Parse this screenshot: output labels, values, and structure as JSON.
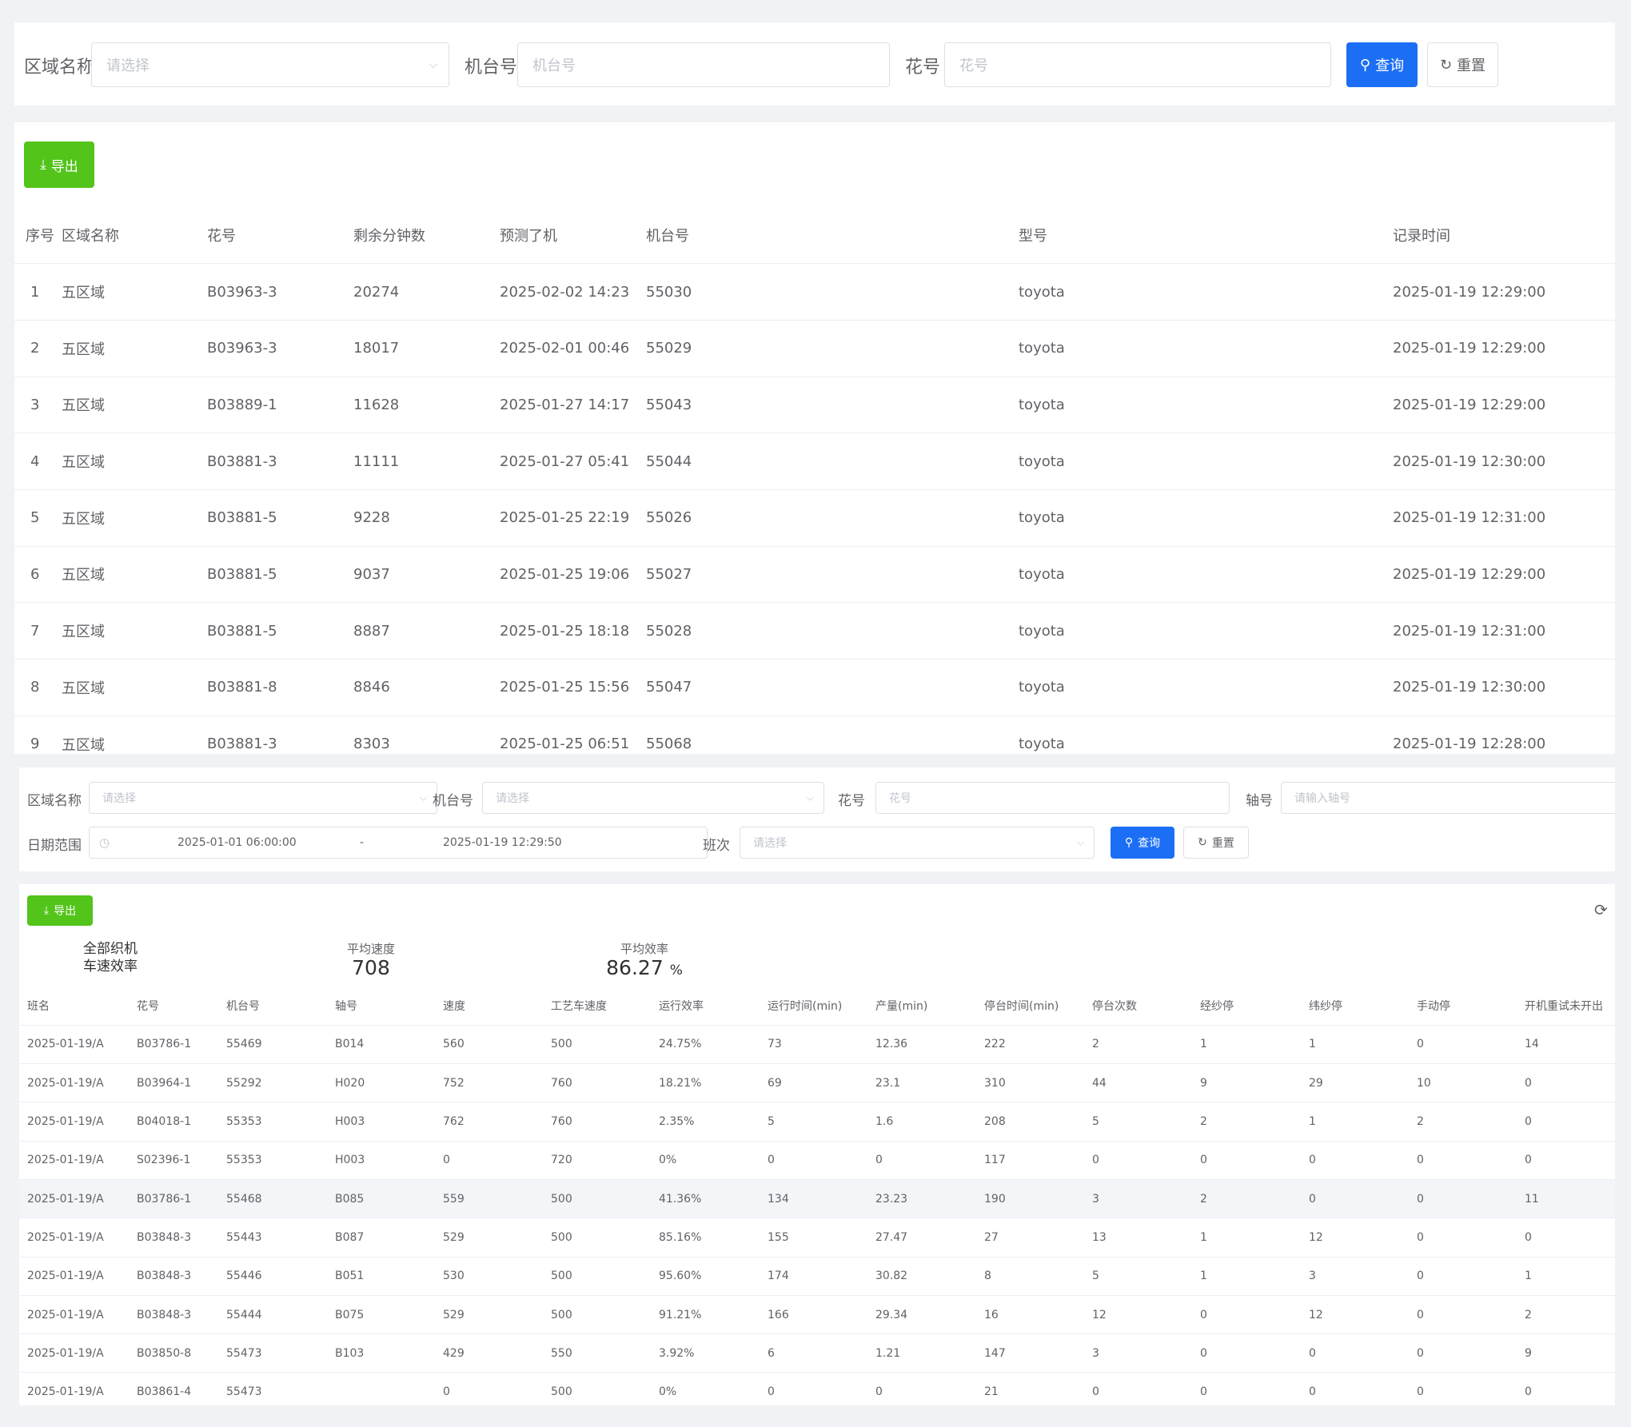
{
  "filter1": {
    "area_label": "区域名称",
    "area_placeholder": "请选择",
    "machine_label": "机台号",
    "machine_placeholder": "机台号",
    "pattern_label": "花号",
    "pattern_placeholder": "花号",
    "query_label": "查询",
    "reset_label": "重置"
  },
  "table1": {
    "export_label": "导出",
    "headers": [
      "序号",
      "区域名称",
      "花号",
      "剩余分钟数",
      "预测了机",
      "机台号",
      "型号",
      "记录时间"
    ],
    "rows": [
      [
        "1",
        "五区域",
        "B03963-3",
        "20274",
        "2025-02-02 14:23",
        "55030",
        "toyota",
        "2025-01-19 12:29:00"
      ],
      [
        "2",
        "五区域",
        "B03963-3",
        "18017",
        "2025-02-01 00:46",
        "55029",
        "toyota",
        "2025-01-19 12:29:00"
      ],
      [
        "3",
        "五区域",
        "B03889-1",
        "11628",
        "2025-01-27 14:17",
        "55043",
        "toyota",
        "2025-01-19 12:29:00"
      ],
      [
        "4",
        "五区域",
        "B03881-3",
        "11111",
        "2025-01-27 05:41",
        "55044",
        "toyota",
        "2025-01-19 12:30:00"
      ],
      [
        "5",
        "五区域",
        "B03881-5",
        "9228",
        "2025-01-25 22:19",
        "55026",
        "toyota",
        "2025-01-19 12:31:00"
      ],
      [
        "6",
        "五区域",
        "B03881-5",
        "9037",
        "2025-01-25 19:06",
        "55027",
        "toyota",
        "2025-01-19 12:29:00"
      ],
      [
        "7",
        "五区域",
        "B03881-5",
        "8887",
        "2025-01-25 18:18",
        "55028",
        "toyota",
        "2025-01-19 12:31:00"
      ],
      [
        "8",
        "五区域",
        "B03881-8",
        "8846",
        "2025-01-25 15:56",
        "55047",
        "toyota",
        "2025-01-19 12:30:00"
      ],
      [
        "9",
        "五区域",
        "B03881-3",
        "8303",
        "2025-01-25 06:51",
        "55068",
        "toyota",
        "2025-01-19 12:28:00"
      ]
    ]
  },
  "filter2": {
    "area_label": "区域名称",
    "area_placeholder": "请选择",
    "machine_label": "机台号",
    "machine_placeholder": "请选择",
    "pattern_label": "花号",
    "pattern_placeholder": "花号",
    "axis_label": "轴号",
    "axis_placeholder": "请输入轴号",
    "date_label": "日期范围",
    "date_start": "2025-01-01 06:00:00",
    "date_sep": "-",
    "date_end": "2025-01-19 12:29:50",
    "shift_label": "班次",
    "shift_placeholder": "请选择",
    "query_label": "查询",
    "reset_label": "重置"
  },
  "table2": {
    "export_label": "导出",
    "stats": {
      "title_line1": "全部织机",
      "title_line2": "车速效率",
      "avg_speed_label": "平均速度",
      "avg_speed_value": "708",
      "avg_eff_label": "平均效率",
      "avg_eff_value": "86.27",
      "avg_eff_unit": "%"
    },
    "headers": [
      "班名",
      "花号",
      "机台号",
      "轴号",
      "速度",
      "工艺车速度",
      "运行效率",
      "运行时间(min)",
      "产量(min)",
      "停台时间(min)",
      "停台次数",
      "经纱停",
      "纬纱停",
      "手动停",
      "开机重试未开出"
    ],
    "rows": [
      [
        "2025-01-19/A",
        "B03786-1",
        "55469",
        "B014",
        "560",
        "500",
        "24.75%",
        "73",
        "12.36",
        "222",
        "2",
        "1",
        "1",
        "0",
        "14"
      ],
      [
        "2025-01-19/A",
        "B03964-1",
        "55292",
        "H020",
        "752",
        "760",
        "18.21%",
        "69",
        "23.1",
        "310",
        "44",
        "9",
        "29",
        "10",
        "0"
      ],
      [
        "2025-01-19/A",
        "B04018-1",
        "55353",
        "H003",
        "762",
        "760",
        "2.35%",
        "5",
        "1.6",
        "208",
        "5",
        "2",
        "1",
        "2",
        "0"
      ],
      [
        "2025-01-19/A",
        "S02396-1",
        "55353",
        "H003",
        "0",
        "720",
        "0%",
        "0",
        "0",
        "117",
        "0",
        "0",
        "0",
        "0",
        "0"
      ],
      [
        "2025-01-19/A",
        "B03786-1",
        "55468",
        "B085",
        "559",
        "500",
        "41.36%",
        "134",
        "23.23",
        "190",
        "3",
        "2",
        "0",
        "0",
        "11"
      ],
      [
        "2025-01-19/A",
        "B03848-3",
        "55443",
        "B087",
        "529",
        "500",
        "85.16%",
        "155",
        "27.47",
        "27",
        "13",
        "1",
        "12",
        "0",
        "0"
      ],
      [
        "2025-01-19/A",
        "B03848-3",
        "55446",
        "B051",
        "530",
        "500",
        "95.60%",
        "174",
        "30.82",
        "8",
        "5",
        "1",
        "3",
        "0",
        "1"
      ],
      [
        "2025-01-19/A",
        "B03848-3",
        "55444",
        "B075",
        "529",
        "500",
        "91.21%",
        "166",
        "29.34",
        "16",
        "12",
        "0",
        "12",
        "0",
        "2"
      ],
      [
        "2025-01-19/A",
        "B03850-8",
        "55473",
        "B103",
        "429",
        "550",
        "3.92%",
        "6",
        "1.21",
        "147",
        "3",
        "0",
        "0",
        "0",
        "9"
      ],
      [
        "2025-01-19/A",
        "B03861-4",
        "55473",
        "",
        "0",
        "500",
        "0%",
        "0",
        "0",
        "21",
        "0",
        "0",
        "0",
        "0",
        "0"
      ]
    ]
  },
  "colors": {
    "primary": "#1c6ff5",
    "export_green": "#52c41a",
    "row_highlight": "#f3f5f9"
  }
}
